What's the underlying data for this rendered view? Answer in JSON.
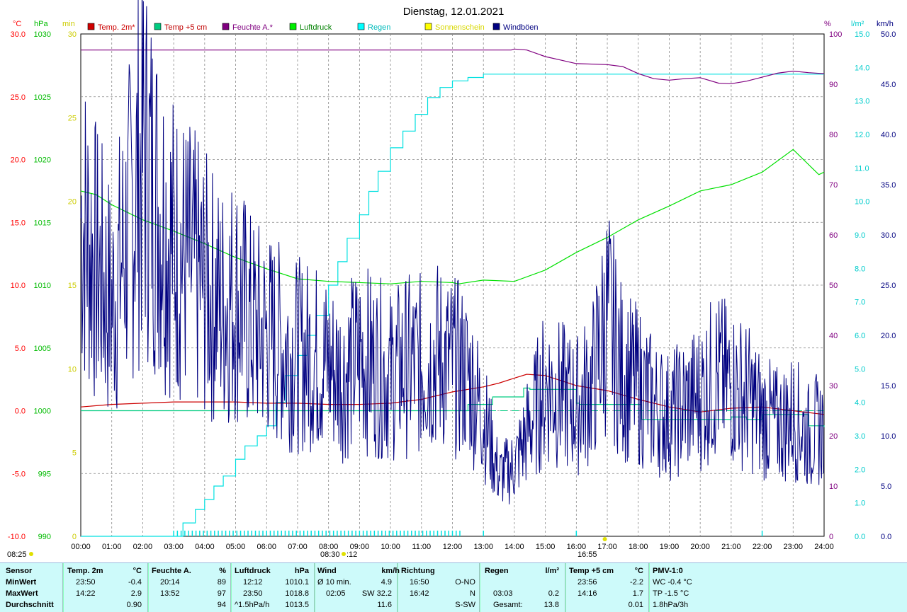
{
  "title": "Dienstag, 12.01.2021",
  "axes": {
    "left_units": [
      "°C",
      "hPa",
      "min"
    ],
    "right_units": [
      "%",
      "l/m²",
      "km/h"
    ],
    "temp_ticks": [
      "30.0",
      "25.0",
      "20.0",
      "15.0",
      "10.0",
      "5.0",
      "0.0",
      "-5.0",
      "-10.0"
    ],
    "hpa_ticks": [
      "1030",
      "1025",
      "1020",
      "1015",
      "1010",
      "1005",
      "1000",
      "995",
      "990"
    ],
    "min_ticks": [
      "30",
      "25",
      "20",
      "15",
      "10",
      "5",
      "0"
    ],
    "pct_ticks": [
      "100",
      "90",
      "80",
      "70",
      "60",
      "50",
      "40",
      "30",
      "20",
      "10",
      "0"
    ],
    "rain_ticks": [
      "15.0",
      "14.0",
      "13.0",
      "12.0",
      "11.0",
      "10.0",
      "9.0",
      "8.0",
      "7.0",
      "6.0",
      "5.0",
      "4.0",
      "3.0",
      "2.0",
      "1.0",
      "0.0"
    ],
    "wind_ticks": [
      "50.0",
      "45.0",
      "40.0",
      "35.0",
      "30.0",
      "25.0",
      "20.0",
      "15.0",
      "10.0",
      "5.0",
      "0.0"
    ],
    "time_ticks": [
      "00:00",
      "01:00",
      "02:00",
      "03:00",
      "04:00",
      "05:00",
      "06:00",
      "07:00",
      "08:00",
      "09:00",
      "10:00",
      "11:00",
      "12:00",
      "13:00",
      "14:00",
      "15:00",
      "16:00",
      "17:00",
      "18:00",
      "19:00",
      "20:00",
      "21:00",
      "22:00",
      "23:00",
      "24:00"
    ],
    "colors": {
      "temp": "#ff0000",
      "hpa": "#00bb00",
      "min": "#cccc00",
      "pct": "#800080",
      "rain": "#00cccc",
      "wind": "#000080"
    }
  },
  "legend": [
    {
      "label": "Temp. 2m*",
      "color": "#d00000",
      "text_color": "#cc0000"
    },
    {
      "label": "Temp +5 cm",
      "color": "#00cc80",
      "text_color": "#c00000"
    },
    {
      "label": "Feuchte A.*",
      "color": "#800080",
      "text_color": "#800080"
    },
    {
      "label": "Luftdruck",
      "color": "#00ee00",
      "text_color": "#008000"
    },
    {
      "label": "Regen",
      "color": "#00ffff",
      "text_color": "#00bbbb"
    },
    {
      "label": "Sonnenschein",
      "color": "#ffff00",
      "text_color": "#d8d800"
    },
    {
      "label": "Windböen",
      "color": "#000080",
      "text_color": "#000080"
    }
  ],
  "markers": {
    "sunrise": "08:25",
    "sun_mid": "08:30",
    "sun_mid2": ":12",
    "sunset": "16:55"
  },
  "chart_data": {
    "type": "line",
    "title": "Dienstag, 12.01.2021",
    "x_range": [
      "00:00",
      "24:00"
    ],
    "ylim_temp": [
      -10,
      30
    ],
    "ylim_hpa": [
      990,
      1030
    ],
    "ylim_min": [
      0,
      30
    ],
    "ylim_pct": [
      0,
      100
    ],
    "ylim_rain": [
      0,
      15
    ],
    "ylim_wind": [
      0,
      50
    ],
    "grid": true,
    "series": [
      {
        "name": "Temp. 2m*",
        "axis": "temp",
        "x": [
          0,
          0.5,
          1,
          2,
          3,
          4,
          5,
          6,
          7,
          8,
          9,
          10,
          11,
          12,
          13,
          13.5,
          14,
          14.4,
          15,
          16,
          17,
          18,
          19,
          20,
          21,
          22,
          23,
          24
        ],
        "values": [
          0.3,
          0.4,
          0.5,
          0.6,
          0.7,
          0.7,
          0.7,
          0.6,
          0.6,
          0.5,
          0.5,
          0.6,
          0.9,
          1.5,
          1.9,
          2.2,
          2.6,
          2.9,
          2.8,
          2.0,
          1.6,
          0.9,
          0.3,
          -0.1,
          0.2,
          0.3,
          0,
          -0.3
        ]
      },
      {
        "name": "Temp +5 cm",
        "axis": "temp",
        "x": [
          0,
          12.4,
          12.5,
          13.3,
          14.3,
          14.5,
          16,
          16.1,
          17,
          18.1,
          21,
          21.5,
          22,
          23.5,
          24
        ],
        "values": [
          0,
          0,
          0.5,
          1.1,
          1.8,
          1.7,
          0.6,
          0.5,
          0.5,
          -0.7,
          -0.5,
          -0.7,
          -0.3,
          -1.2,
          -1.3
        ]
      },
      {
        "name": "Feuchte A.*",
        "axis": "pct",
        "x": [
          0,
          13.9,
          14,
          14.4,
          15,
          15.5,
          16,
          17,
          17.5,
          18,
          18.5,
          19,
          19.5,
          20,
          20.6,
          21,
          21.5,
          22,
          22.5,
          23,
          23.5,
          24
        ],
        "values": [
          96.8,
          96.8,
          97,
          96.8,
          95.5,
          94.8,
          94.1,
          93.9,
          93.5,
          92.1,
          91.1,
          90.8,
          91.1,
          91.3,
          90.2,
          90.1,
          90.6,
          91.4,
          92.2,
          92.6,
          92.3,
          92.1
        ]
      },
      {
        "name": "Luftdruck",
        "axis": "hpa",
        "x": [
          0,
          0.5,
          1,
          2,
          3,
          4,
          5,
          6,
          7,
          8,
          9,
          10,
          11,
          12,
          12.2,
          13,
          14,
          15,
          16,
          17,
          18,
          19,
          20,
          21,
          22,
          23,
          23.83,
          24
        ],
        "values": [
          1017.5,
          1017.2,
          1016.4,
          1015.2,
          1014.3,
          1013.3,
          1012.2,
          1011.3,
          1010.5,
          1010.3,
          1010.2,
          1010.1,
          1010.3,
          1010.2,
          1010.1,
          1010.4,
          1010.3,
          1011.2,
          1012.6,
          1013.8,
          1015.2,
          1016.3,
          1017.5,
          1018,
          1019,
          1020.8,
          1018.8,
          1019
        ]
      },
      {
        "name": "Regen",
        "axis": "rain",
        "x": [
          0,
          3.0,
          3.3,
          3.7,
          4.0,
          4.3,
          4.6,
          5.0,
          5.3,
          5.7,
          6.0,
          6.3,
          6.6,
          7.0,
          7.3,
          7.6,
          8.0,
          8.3,
          8.6,
          9.0,
          9.3,
          9.6,
          10.0,
          10.4,
          10.8,
          11.2,
          11.6,
          12.0,
          12.5,
          13,
          14,
          15,
          16,
          17,
          18,
          19,
          20,
          21,
          22,
          23,
          24
        ],
        "values": [
          0,
          0,
          0.4,
          0.8,
          1.1,
          1.5,
          1.8,
          2.3,
          2.7,
          3.0,
          3.3,
          4.0,
          4.8,
          5.4,
          6.0,
          6.6,
          7.5,
          8.2,
          8.9,
          9.6,
          10.3,
          10.9,
          11.6,
          12.1,
          12.6,
          13.1,
          13.4,
          13.6,
          13.7,
          13.8,
          13.8,
          13.8,
          13.8,
          13.8,
          13.8,
          13.8,
          13.8,
          13.8,
          13.8,
          13.8,
          13.8
        ]
      },
      {
        "name": "Windböen",
        "axis": "wind",
        "note": "gust trace",
        "x": [
          0,
          0.5,
          1,
          1.5,
          2,
          2.5,
          3,
          3.5,
          4,
          4.5,
          5,
          5.5,
          6,
          6.5,
          7,
          7.5,
          8,
          8.5,
          9,
          9.5,
          10,
          10.5,
          11,
          11.5,
          12,
          12.5,
          13,
          13.5,
          14,
          14.5,
          15,
          15.5,
          16,
          16.5,
          17,
          17.5,
          18,
          18.5,
          19,
          19.5,
          20,
          20.5,
          21,
          21.5,
          22,
          22.5,
          23,
          23.5,
          24
        ],
        "values": [
          32,
          27,
          23,
          30,
          38,
          33,
          29,
          27,
          25,
          23,
          24,
          21,
          20,
          19,
          18,
          18,
          17,
          16,
          18,
          17,
          16,
          17,
          17,
          18,
          17,
          16,
          12,
          6,
          7,
          11,
          15,
          14,
          13,
          15,
          22,
          16,
          15,
          13,
          12,
          13,
          14,
          16,
          15,
          14,
          12,
          11,
          12,
          10,
          11
        ]
      }
    ]
  },
  "stats": {
    "header": {
      "sensor": "Sensor",
      "temp2m": "Temp. 2m",
      "temp2m_u": "°C",
      "feuchte": "Feuchte A.",
      "feuchte_u": "%",
      "luft": "Luftdruck",
      "luft_u": "hPa",
      "wind": "Wind",
      "wind_u": "km/h",
      "richtung": "Richtung",
      "regen": "Regen",
      "regen_u": "l/m²",
      "temp5": "Temp +5 cm",
      "temp5_u": "°C",
      "pmv": "PMV-1:0"
    },
    "row_labels": [
      "MinWert",
      "MaxWert",
      "Durchschnitt"
    ],
    "temp2m": [
      [
        "23:50",
        "-0.4"
      ],
      [
        "14:22",
        "2.9"
      ],
      [
        "",
        "0.90"
      ]
    ],
    "feuchte": [
      [
        "20:14",
        "89"
      ],
      [
        "13:52",
        "97"
      ],
      [
        "",
        "94"
      ]
    ],
    "luft": [
      [
        "12:12",
        "1010.1"
      ],
      [
        "23:50",
        "1018.8"
      ],
      [
        "^1.5hPa/h",
        "1013.5"
      ]
    ],
    "wind": [
      [
        "Ø 10 min.",
        "4.9"
      ],
      [
        "02:05",
        "SW 32.2"
      ],
      [
        "",
        "11.6"
      ]
    ],
    "richtung": [
      [
        "16:50",
        "O-NO"
      ],
      [
        "16:42",
        "N"
      ],
      [
        "",
        "S-SW"
      ]
    ],
    "regen": [
      [
        "",
        ""
      ],
      [
        "03:03",
        "0.2"
      ],
      [
        "Gesamt:",
        "13.8"
      ]
    ],
    "temp5": [
      [
        "23:56",
        "-2.2"
      ],
      [
        "14:16",
        "1.7"
      ],
      [
        "",
        "0.01"
      ]
    ],
    "pmv": [
      "WC -0.4 °C",
      "TP -1.5 °C",
      "1.8hPa/3h"
    ]
  }
}
